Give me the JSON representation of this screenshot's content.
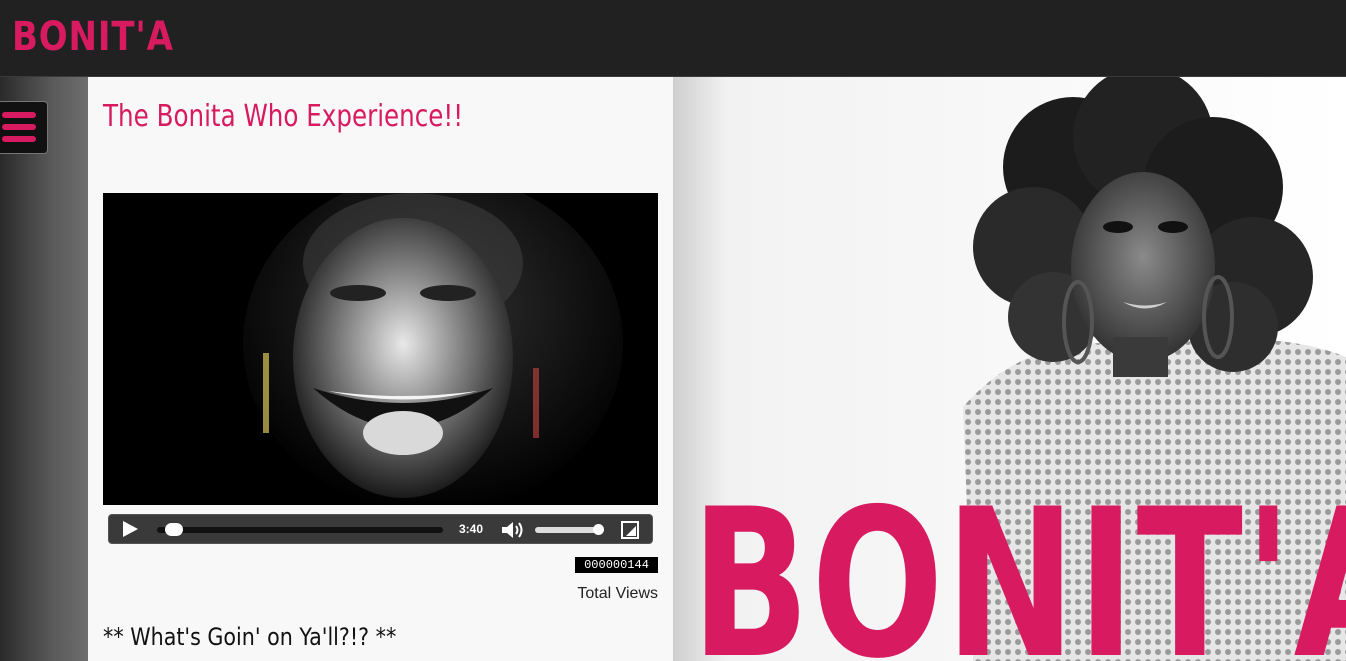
{
  "header": {
    "logo_text": "BONIT'A"
  },
  "nav": {
    "menu_icon": "hamburger-icon"
  },
  "main": {
    "title": "The Bonita Who Experience!!",
    "video": {
      "duration": "3:40",
      "progress": 0.02,
      "volume": 0.92,
      "icons": [
        "play-icon",
        "volume-icon",
        "fullscreen-icon"
      ]
    },
    "views": {
      "count": "000000144",
      "label": "Total Views"
    },
    "greeting": "** What's Goin' on Ya'll?!? **"
  },
  "hero": {
    "brand_text": "BONIT'A"
  },
  "colors": {
    "accent": "#d81b60",
    "topbar": "#212121",
    "content_bg": "#f8f8f8"
  }
}
